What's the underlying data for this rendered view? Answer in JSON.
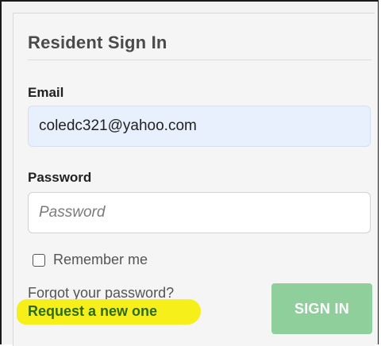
{
  "signin": {
    "title": "Resident Sign In",
    "email_label": "Email",
    "email_value": "coledc321@yahoo.com",
    "password_label": "Password",
    "password_placeholder": "Password",
    "remember_label": "Remember me",
    "remember_checked": false,
    "forgot_text": "Forgot your password?",
    "request_link": "Request a new one",
    "submit_label": "SIGN IN"
  },
  "colors": {
    "highlight": "#f6ef1a",
    "link": "#2f6b1c",
    "button": "#8fcf9c",
    "email_autofill_bg": "#e8f0fe"
  }
}
